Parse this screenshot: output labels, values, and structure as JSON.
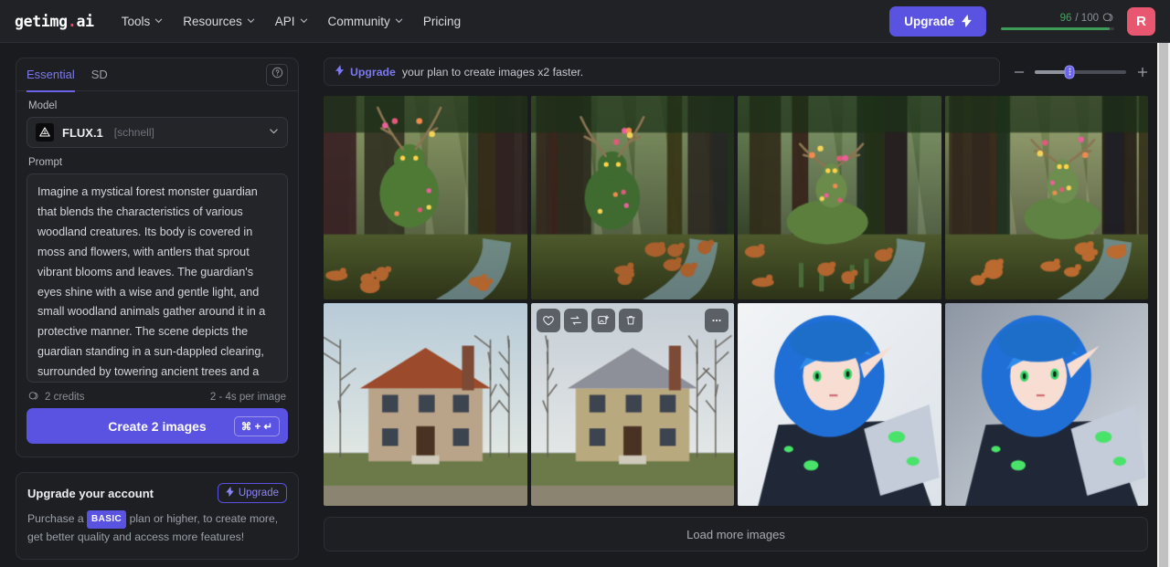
{
  "header": {
    "logo_text": "getimg",
    "logo_dot": ".",
    "logo_suffix": "ai",
    "nav": [
      {
        "label": "Tools",
        "has_chevron": true
      },
      {
        "label": "Resources",
        "has_chevron": true
      },
      {
        "label": "API",
        "has_chevron": true
      },
      {
        "label": "Community",
        "has_chevron": true
      },
      {
        "label": "Pricing",
        "has_chevron": false
      }
    ],
    "upgrade_label": "Upgrade",
    "credits_used": "96",
    "credits_sep": "/ 100",
    "credits_percent": 96,
    "avatar_initial": "R",
    "accent_purple": "#5a52e0",
    "avatar_color": "#e8566f",
    "credit_green": "#3f9c58"
  },
  "sidebar": {
    "tabs": [
      {
        "label": "Essential",
        "active": true
      },
      {
        "label": "SD",
        "active": false
      }
    ],
    "help_icon": "question-circle-icon",
    "model_label": "Model",
    "model_name": "FLUX.1",
    "model_variant": "[schnell]",
    "prompt_label": "Prompt",
    "prompt_text": "Imagine a mystical forest monster guardian that blends the characteristics of various woodland creatures. Its body is covered in moss and flowers, with antlers that sprout vibrant blooms and leaves. The guardian's eyes shine with a wise and gentle light, and small woodland animals gather around it in a protective manner. The scene depicts the guardian standing in a sun-dappled clearing, surrounded by towering ancient trees and a sparkling stream that reflects the light.",
    "credits_cost": "2 credits",
    "speed_estimate": "2 - 4s per image",
    "create_label": "Create 2 images",
    "shortcut": "⌘ + ↵",
    "account_card": {
      "title": "Upgrade your account",
      "upgrade_label": "Upgrade",
      "desc_before": "Purchase a",
      "badge": "BASIC",
      "desc_after": "plan or higher, to create more, get better quality and access more features!"
    }
  },
  "main": {
    "promo_link": "Upgrade",
    "promo_text": "your plan to create images x2 faster.",
    "zoom_minus": "−",
    "zoom_plus": "+",
    "zoom_value": 38,
    "load_more_label": "Load more images",
    "hover_actions": [
      {
        "name": "favorite-icon",
        "glyph": "heart"
      },
      {
        "name": "regenerate-icon",
        "glyph": "repeat"
      },
      {
        "name": "variations-icon",
        "glyph": "image-plus"
      },
      {
        "name": "delete-icon",
        "glyph": "trash"
      }
    ],
    "more_action": {
      "name": "more-options-icon",
      "glyph": "ellipsis"
    },
    "images": [
      {
        "id": "img-1",
        "alt": "mossy forest guardian monster with flowered antlers surrounded by deer",
        "scene": "guardian"
      },
      {
        "id": "img-2",
        "alt": "green forest guardian creature kneeling with small animals",
        "scene": "guardian2"
      },
      {
        "id": "img-3",
        "alt": "mossy stag with blossom antlers beside forest stream",
        "scene": "stag"
      },
      {
        "id": "img-4",
        "alt": "moss covered deer with flower antlers in sunlit forest",
        "scene": "stag2"
      },
      {
        "id": "img-5",
        "alt": "brick and wood two story house with porch",
        "scene": "house1"
      },
      {
        "id": "img-6",
        "alt": "beige two story house with dormer and bare trees",
        "scene": "house2",
        "hovered": true
      },
      {
        "id": "img-7",
        "alt": "anime elf girl with blue hair green eyes and white green armor",
        "scene": "anime1"
      },
      {
        "id": "img-8",
        "alt": "anime elf warrior blue hair glowing armor snowy background",
        "scene": "anime2"
      }
    ]
  }
}
